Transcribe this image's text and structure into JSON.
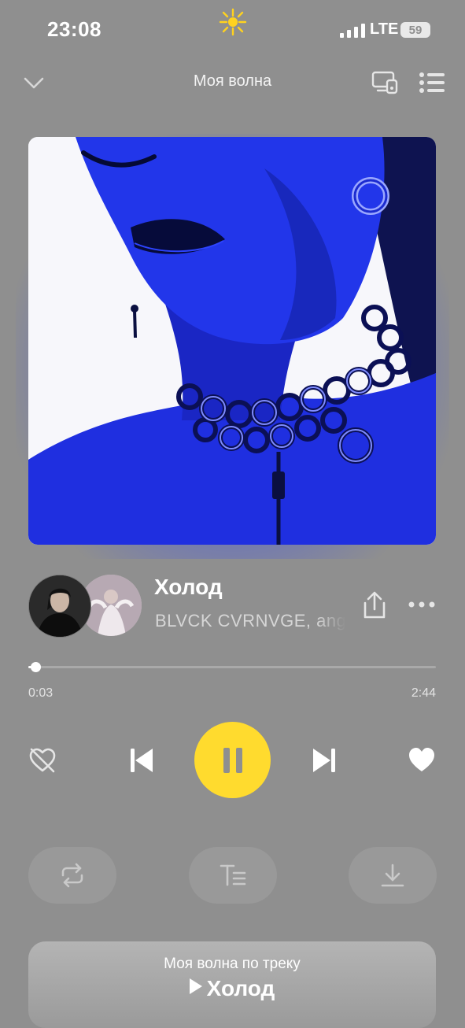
{
  "status_bar": {
    "time": "23:08",
    "network": "LTE",
    "battery": "59"
  },
  "header": {
    "title": "Моя волна",
    "icons": [
      "chevron-down-icon",
      "device-icon",
      "queue-icon"
    ]
  },
  "track": {
    "title": "Холод",
    "artist": "BLVCK CVRNVGE, angelic"
  },
  "progress": {
    "current": "0:03",
    "duration": "2:44",
    "fraction": 0.018
  },
  "controls": [
    "dislike-icon",
    "previous-icon",
    "pause-icon",
    "next-icon",
    "like-icon"
  ],
  "actions": [
    "repeat-icon",
    "lyrics-icon",
    "download-icon"
  ],
  "bottom_card": {
    "title": "Моя волна по треку",
    "track": "Холод"
  },
  "colors": {
    "background": "#8f8f8f",
    "accent": "#ffdb2e",
    "cover_blue": "#1f2fe0"
  }
}
